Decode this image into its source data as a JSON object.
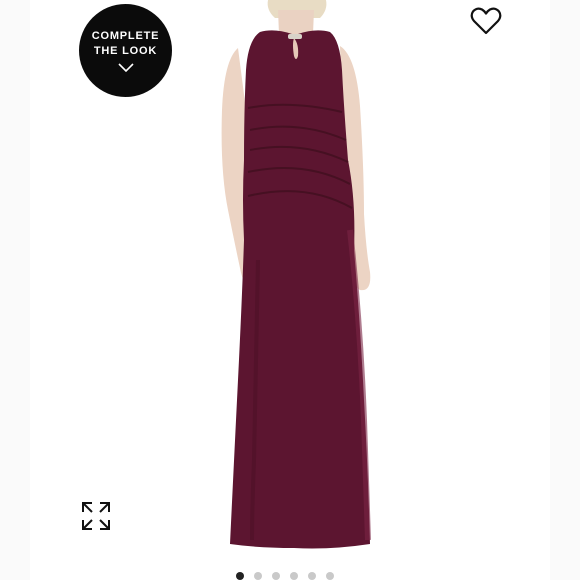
{
  "complete_look": {
    "line1": "COMPLETE",
    "line2": "THE LOOK",
    "icon": "chevron-down-icon"
  },
  "favorite": {
    "icon": "heart-outline-icon"
  },
  "expand": {
    "icon": "expand-arrows-icon"
  },
  "product": {
    "dress_color": "#5c1530",
    "background_color": "#ffffff"
  },
  "carousel": {
    "total": 6,
    "active_index": 0
  }
}
